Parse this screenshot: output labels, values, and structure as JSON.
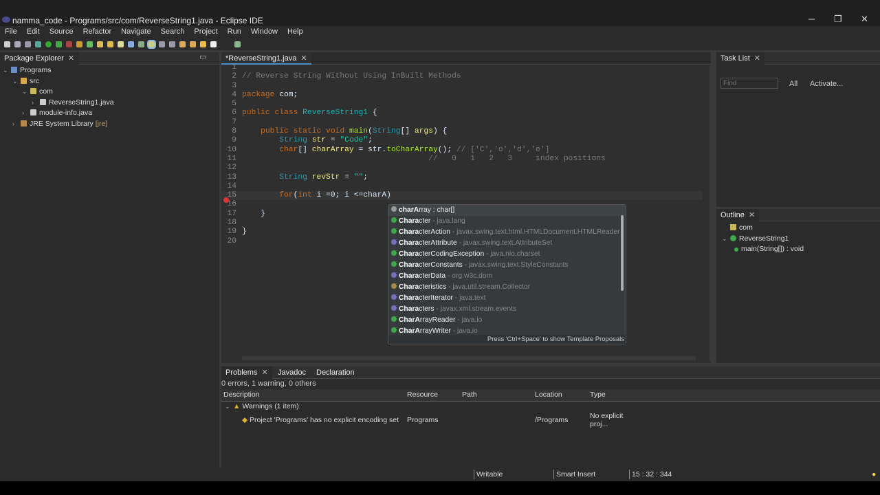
{
  "window": {
    "title": "namma_code - Programs/src/com/ReverseString1.java - Eclipse IDE",
    "minimize": "─",
    "restore": "❐",
    "close": "✕"
  },
  "menu": [
    "File",
    "Edit",
    "Source",
    "Refactor",
    "Navigate",
    "Search",
    "Project",
    "Run",
    "Window",
    "Help"
  ],
  "package_explorer": {
    "title": "Package Explorer",
    "tree": [
      {
        "label": "Programs",
        "depth": 0,
        "icon": "project-icon",
        "expanded": true
      },
      {
        "label": "src",
        "depth": 1,
        "icon": "source-folder-icon",
        "expanded": true
      },
      {
        "label": "com",
        "depth": 2,
        "icon": "package-icon",
        "expanded": true
      },
      {
        "label": "ReverseString1.java",
        "depth": 3,
        "icon": "java-file-icon",
        "expanded": false
      },
      {
        "label": "module-info.java",
        "depth": 2,
        "icon": "java-file-icon",
        "expanded": false
      },
      {
        "label": "JRE System Library",
        "suffix": "[jre]",
        "depth": 1,
        "icon": "library-icon",
        "expanded": false
      }
    ]
  },
  "editor": {
    "tab": "*ReverseString1.java",
    "lines": [
      {
        "n": "1",
        "t": []
      },
      {
        "n": "2",
        "t": [
          [
            "cm",
            "// Reverse String Without Using InBuilt Methods"
          ]
        ]
      },
      {
        "n": "3",
        "t": []
      },
      {
        "n": "4",
        "t": [
          [
            "kw",
            "package"
          ],
          [
            "p",
            " com;"
          ]
        ]
      },
      {
        "n": "5",
        "t": []
      },
      {
        "n": "6",
        "t": [
          [
            "kw",
            "public class "
          ],
          [
            "cls",
            "ReverseString1"
          ],
          [
            "p",
            " {"
          ]
        ]
      },
      {
        "n": "7",
        "t": []
      },
      {
        "n": "8",
        "t": [
          [
            "p",
            "    "
          ],
          [
            "kw",
            "public static void "
          ],
          [
            "m",
            "main"
          ],
          [
            "p",
            "("
          ],
          [
            "ty",
            "String"
          ],
          [
            "p",
            "[] "
          ],
          [
            "v",
            "args"
          ],
          [
            "p",
            ") {"
          ]
        ]
      },
      {
        "n": "9",
        "t": [
          [
            "p",
            "        "
          ],
          [
            "ty",
            "String "
          ],
          [
            "v",
            "str"
          ],
          [
            "p",
            " = "
          ],
          [
            "s",
            "\"Code\""
          ],
          [
            "p",
            ";"
          ]
        ]
      },
      {
        "n": "10",
        "t": [
          [
            "p",
            "        "
          ],
          [
            "kw",
            "char"
          ],
          [
            "p",
            "[] "
          ],
          [
            "v",
            "charArray"
          ],
          [
            "p",
            " = str."
          ],
          [
            "m",
            "toCharArray"
          ],
          [
            "p",
            "(); "
          ],
          [
            "cm",
            "// ['C','o','d','e']"
          ]
        ]
      },
      {
        "n": "11",
        "t": [
          [
            "p",
            "                                        "
          ],
          [
            "cm",
            "//   0   1   2   3     index positions"
          ]
        ]
      },
      {
        "n": "12",
        "t": []
      },
      {
        "n": "13",
        "t": [
          [
            "p",
            "        "
          ],
          [
            "ty",
            "String "
          ],
          [
            "v",
            "revStr"
          ],
          [
            "p",
            " = "
          ],
          [
            "s",
            "\"\""
          ],
          [
            "p",
            ";"
          ]
        ]
      },
      {
        "n": "14",
        "t": []
      },
      {
        "n": "15",
        "t": [
          [
            "p",
            "        "
          ],
          [
            "kw",
            "for"
          ],
          [
            "p",
            "("
          ],
          [
            "kw",
            "int"
          ],
          [
            "p",
            " i =0; i <=charA)"
          ]
        ]
      },
      {
        "n": "16",
        "t": []
      },
      {
        "n": "17",
        "t": [
          [
            "p",
            "    }"
          ]
        ]
      },
      {
        "n": "18",
        "t": []
      },
      {
        "n": "19",
        "t": [
          [
            "p",
            "}"
          ]
        ]
      },
      {
        "n": "20",
        "t": []
      }
    ]
  },
  "completion": {
    "items": [
      {
        "bold": "charA",
        "rest": "rray : char[]",
        "pkg": "",
        "icon": "field-icon",
        "color": "#9a9a9a"
      },
      {
        "bold": "Chara",
        "rest": "cter",
        "pkg": " - java.lang",
        "icon": "class-icon",
        "color": "#3fa84a"
      },
      {
        "bold": "Chara",
        "rest": "cterAction",
        "pkg": " - javax.swing.text.html.HTMLDocument.HTMLReader",
        "icon": "class-icon",
        "color": "#3fa84a"
      },
      {
        "bold": "Chara",
        "rest": "cterAttribute",
        "pkg": " - javax.swing.text.AttributeSet",
        "icon": "interface-icon",
        "color": "#7a6fc0"
      },
      {
        "bold": "Chara",
        "rest": "cterCodingException",
        "pkg": " - java.nio.charset",
        "icon": "class-icon",
        "color": "#3fa84a"
      },
      {
        "bold": "Chara",
        "rest": "cterConstants",
        "pkg": " - javax.swing.text.StyleConstants",
        "icon": "class-icon",
        "color": "#3fa84a"
      },
      {
        "bold": "Chara",
        "rest": "cterData",
        "pkg": " - org.w3c.dom",
        "icon": "interface-icon",
        "color": "#7a6fc0"
      },
      {
        "bold": "Chara",
        "rest": "cteristics",
        "pkg": " - java.util.stream.Collector",
        "icon": "enum-icon",
        "color": "#a88a4a"
      },
      {
        "bold": "Chara",
        "rest": "cterIterator",
        "pkg": " - java.text",
        "icon": "interface-icon",
        "color": "#7a6fc0"
      },
      {
        "bold": "Chara",
        "rest": "cters",
        "pkg": " - javax.xml.stream.events",
        "icon": "interface-icon",
        "color": "#7a6fc0"
      },
      {
        "bold": "CharA",
        "rest": "rrayReader",
        "pkg": " - java.io",
        "icon": "class-icon",
        "color": "#3fa84a"
      },
      {
        "bold": "CharA",
        "rest": "rrayWriter",
        "pkg": " - java.io",
        "icon": "class-icon",
        "color": "#3fa84a"
      }
    ],
    "footer": "Press 'Ctrl+Space' to show Template Proposals"
  },
  "task_list": {
    "title": "Task List",
    "find_placeholder": "Find",
    "all": "All",
    "activate": "Activate..."
  },
  "outline": {
    "title": "Outline",
    "items": [
      {
        "label": "com"
      },
      {
        "label": "ReverseString1"
      },
      {
        "label": "main(String[]) : void"
      }
    ]
  },
  "problems": {
    "tabs": [
      "Problems",
      "Javadoc",
      "Declaration"
    ],
    "summary": "0 errors, 1 warning, 0 others",
    "columns": [
      "Description",
      "Resource",
      "Path",
      "Location",
      "Type"
    ],
    "group": "Warnings (1 item)",
    "rows": [
      {
        "description": "Project 'Programs' has no explicit encoding set",
        "resource": "Programs",
        "path": "",
        "location": "/Programs",
        "type": "No explicit proj..."
      }
    ]
  },
  "status": {
    "writable": "Writable",
    "insert_mode": "Smart Insert",
    "position": "15 : 32 : 344"
  }
}
